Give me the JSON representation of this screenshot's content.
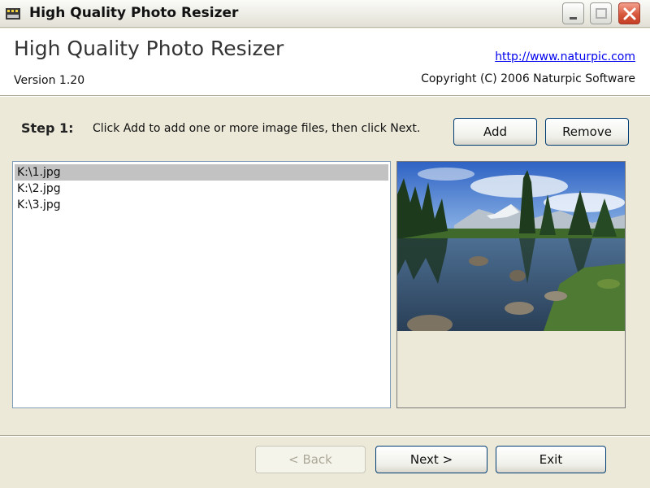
{
  "window": {
    "title": "High Quality Photo Resizer"
  },
  "header": {
    "app_name": "High Quality Photo Resizer",
    "version": "Version 1.20",
    "link": "http://www.naturpic.com",
    "copyright": "Copyright (C) 2006 Naturpic Software"
  },
  "step": {
    "label": "Step 1:",
    "instruction": "Click Add to add one or more image files, then click Next."
  },
  "buttons": {
    "add": "Add",
    "remove": "Remove",
    "back": "< Back",
    "next": "Next >",
    "exit": "Exit"
  },
  "files": [
    "K:\\1.jpg",
    "K:\\2.jpg",
    "K:\\3.jpg"
  ],
  "selected_file_index": 0,
  "colors": {
    "link": "#0000ee",
    "dialog_bg": "#ece9d8",
    "selection": "#c2c2c2",
    "close_button": "#d7583d"
  },
  "icons": {
    "app": "film-strip-icon",
    "minimize": "minimize-icon",
    "maximize": "maximize-icon",
    "close": "close-icon"
  }
}
